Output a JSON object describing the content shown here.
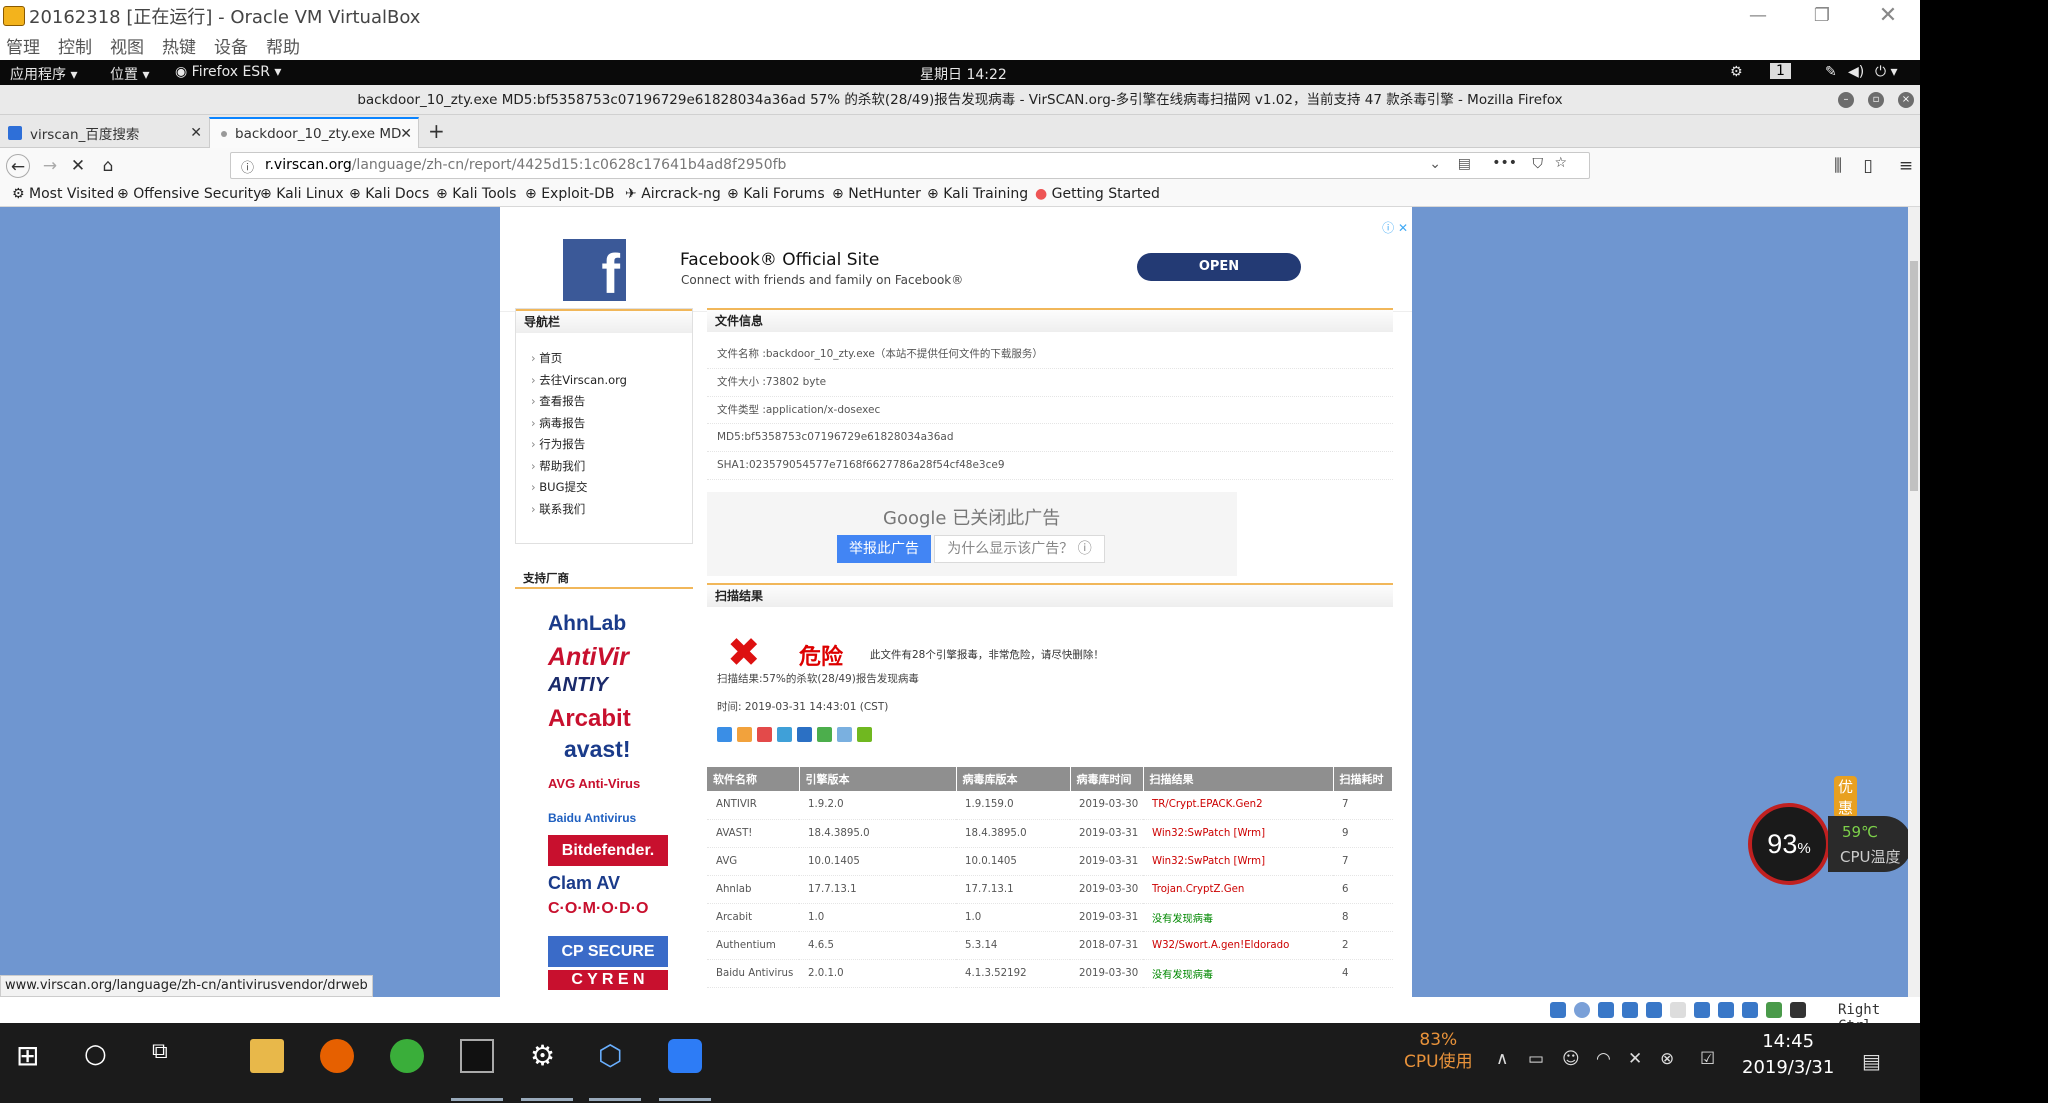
{
  "vbox": {
    "title": "20162318 [正在运行] - Oracle VM VirtualBox",
    "menu": [
      "管理",
      "控制",
      "视图",
      "热键",
      "设备",
      "帮助"
    ],
    "host_key": "Right Ctrl"
  },
  "gnome": {
    "apps": "应用程序 ▾",
    "places": "位置 ▾",
    "browser": "Firefox ESR ▾",
    "clock": "星期日 14:22",
    "workspace": "1"
  },
  "firefox": {
    "title": "backdoor_10_zty.exe MD5:bf5358753c07196729e61828034a36ad 57% 的杀软(28/49)报告发现病毒 - VirSCAN.org-多引擎在线病毒扫描网 v1.02，当前支持 47 款杀毒引擎 - Mozilla Firefox",
    "tabs": [
      {
        "label": "virscan_百度搜索"
      },
      {
        "label": "backdoor_10_zty.exe MD"
      }
    ],
    "url_host": "r.virscan.org",
    "url_path": "/language/zh-cn/report/4425d15:1c0628c17641b4ad8f2950fb",
    "bookmarks": [
      "Most Visited",
      "Offensive Security",
      "Kali Linux",
      "Kali Docs",
      "Kali Tools",
      "Exploit-DB",
      "Aircrack-ng",
      "Kali Forums",
      "NetHunter",
      "Kali Training",
      "Getting Started"
    ],
    "status_url": "www.virscan.org/language/zh-cn/antivirusvendor/drweb"
  },
  "ad": {
    "headline": "Facebook® Official Site",
    "sub": "Connect with friends and family on Facebook®",
    "cta": "OPEN",
    "icon": "facebook-logo"
  },
  "nav": {
    "title": "导航栏",
    "items": [
      "首页",
      "去往Virscan.org",
      "查看报告",
      "病毒报告",
      "行为报告",
      "帮助我们",
      "BUG提交",
      "联系我们"
    ]
  },
  "sponsors": {
    "title": "支持厂商",
    "logos": [
      {
        "name": "AhnLab",
        "color": "#1a3b8a"
      },
      {
        "name": "AntiVir",
        "color": "#c8102e"
      },
      {
        "name": "ANTIY",
        "color": "#1a2a6a"
      },
      {
        "name": "Arcabit",
        "color": "#c8102e"
      },
      {
        "name": "avast!",
        "color": "#1a3b8a"
      },
      {
        "name": "AVG Anti-Virus",
        "color": "#c8102e"
      },
      {
        "name": "Baidu Antivirus",
        "color": "#2060c0"
      },
      {
        "name": "Bitdefender.",
        "color": "#ffffff"
      },
      {
        "name": "Clam AV",
        "color": "#1a3b8a"
      },
      {
        "name": "C·O·M·O·D·O",
        "color": "#c8102e"
      },
      {
        "name": "CP SECURE",
        "color": "#1a3b8a"
      },
      {
        "name": "C Y R E N",
        "color": "#ffffff"
      }
    ]
  },
  "file": {
    "title": "文件信息",
    "lines": [
      "文件名称 :backdoor_10_zty.exe（本站不提供任何文件的下载服务）",
      "文件大小 :73802 byte",
      "文件类型 :application/x-dosexec",
      "MD5:bf5358753c07196729e61828034a36ad",
      "SHA1:023579054577e7168f6627786a28f54cf48e3ce9"
    ]
  },
  "google_ad": {
    "closed": "Google 已关闭此广告",
    "report": "举报此广告",
    "why": "为什么显示该广告？ ⓘ"
  },
  "scan": {
    "title": "扫描结果",
    "danger": "危险",
    "danger_desc": "此文件有28个引擎报毒，非常危险，请尽快删除！",
    "summary": "扫描结果:57%的杀软(28/49)报告发现病毒",
    "time": "时间: 2019-03-31 14:43:01 (CST)"
  },
  "table": {
    "headers": [
      "软件名称",
      "引擎版本",
      "病毒库版本",
      "病毒库时间",
      "扫描结果",
      "扫描耗时"
    ],
    "rows": [
      [
        "ANTIVIR",
        "1.9.2.0",
        "1.9.159.0",
        "2019-03-30",
        "TR/Crypt.EPACK.Gen2",
        "7"
      ],
      [
        "AVAST!",
        "18.4.3895.0",
        "18.4.3895.0",
        "2019-03-31",
        "Win32:SwPatch [Wrm]",
        "9"
      ],
      [
        "AVG",
        "10.0.1405",
        "10.0.1405",
        "2019-03-31",
        "Win32:SwPatch [Wrm]",
        "7"
      ],
      [
        "Ahnlab",
        "17.7.13.1",
        "17.7.13.1",
        "2019-03-30",
        "Trojan.CryptZ.Gen",
        "6"
      ],
      [
        "Arcabit",
        "1.0",
        "1.0",
        "2019-03-31",
        "没有发现病毒",
        "8"
      ],
      [
        "Authentium",
        "4.6.5",
        "5.3.14",
        "2018-07-31",
        "W32/Swort.A.gen!Eldorado",
        "2"
      ],
      [
        "Baidu Antivirus",
        "2.0.1.0",
        "4.1.3.52192",
        "2019-03-30",
        "没有发现病毒",
        "4"
      ]
    ]
  },
  "widget": {
    "cpu_percent": "93",
    "percent_sign": "%",
    "temp": "59℃",
    "temp_label": "CPU温度",
    "promo": "优惠"
  },
  "taskbar": {
    "cpu_usage": "83%",
    "cpu_label": "CPU使用",
    "time": "14:45",
    "date": "2019/3/31"
  }
}
